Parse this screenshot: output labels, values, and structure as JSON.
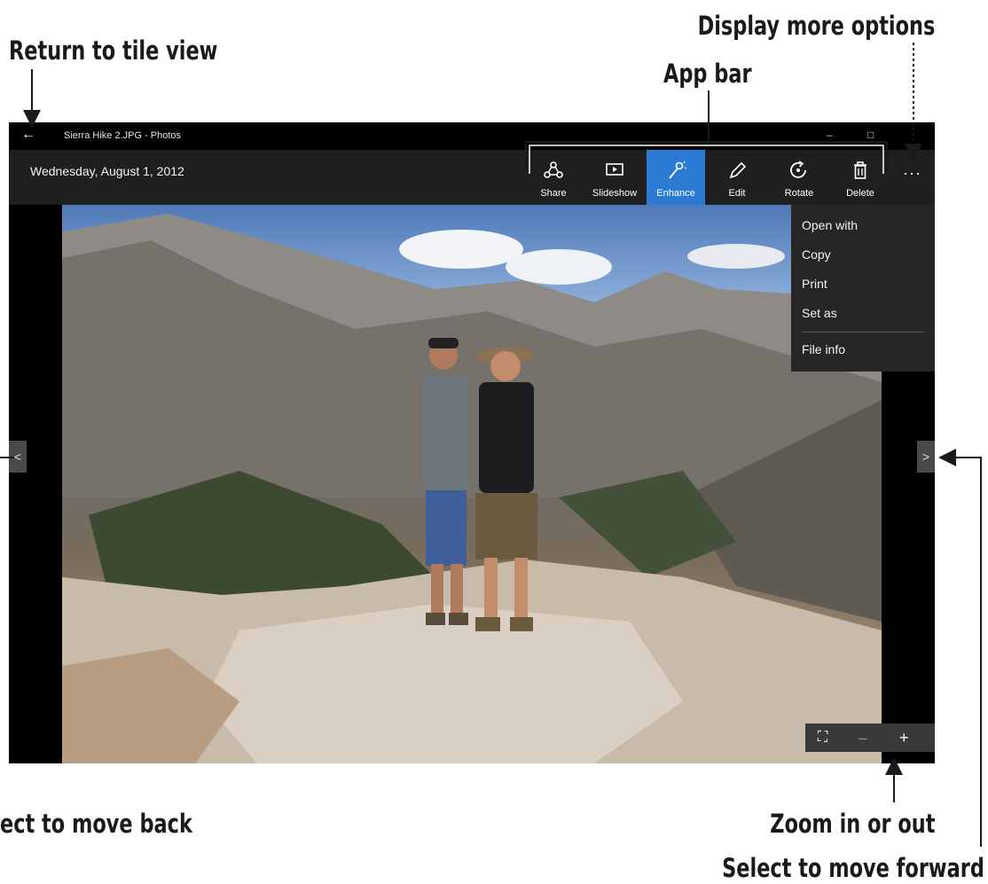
{
  "callouts": {
    "return_tile": "Return to tile view",
    "more_options": "Display more options",
    "app_bar": "App bar",
    "move_back": "ect to move back",
    "zoom": "Zoom in or out",
    "move_forward": "Select to move forward"
  },
  "window": {
    "title": "Sierra Hike 2.JPG - Photos",
    "back_glyph": "←",
    "minimize_glyph": "–",
    "maximize_glyph": "□",
    "date": "Wednesday, August 1, 2012",
    "more_glyph": "···"
  },
  "toolbar": [
    {
      "label": "Share",
      "icon": "share-icon",
      "active": false
    },
    {
      "label": "Slideshow",
      "icon": "slideshow-icon",
      "active": false
    },
    {
      "label": "Enhance",
      "icon": "enhance-wand-icon",
      "active": true
    },
    {
      "label": "Edit",
      "icon": "edit-pencil-icon",
      "active": false
    },
    {
      "label": "Rotate",
      "icon": "rotate-icon",
      "active": false
    },
    {
      "label": "Delete",
      "icon": "trash-icon",
      "active": false
    }
  ],
  "more_menu": {
    "items": [
      "Open with",
      "Copy",
      "Print",
      "Set as",
      "File info"
    ]
  },
  "nav": {
    "prev_glyph": "<",
    "next_glyph": ">"
  },
  "zoom": {
    "fit_glyph": "⛶",
    "minus_glyph": "–",
    "plus_glyph": "+"
  },
  "colors": {
    "accent": "#2b7ad3",
    "appbar": "#1f1f1f",
    "window": "#000000"
  }
}
